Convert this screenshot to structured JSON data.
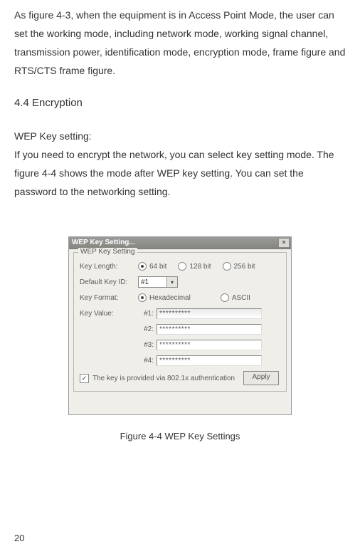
{
  "paragraphs": {
    "intro": "As figure 4-3, when the equipment is in Access Point Mode, the user can set the working mode, including network mode, working signal channel, transmission power, identification mode, encryption mode, frame figure and RTS/CTS frame figure.",
    "heading": "4.4 Encryption",
    "wep_title": "WEP Key setting:",
    "wep_body": "If you need to encrypt the network, you can select key setting mode. The figure 4-4 shows the mode after WEP key setting. You can set the password to the networking setting."
  },
  "dialog": {
    "title": "WEP Key Setting...",
    "close_glyph": "×",
    "groupbox_label": "WEP Key Setting",
    "labels": {
      "key_length": "Key Length:",
      "default_key_id": "Default Key ID:",
      "key_format": "Key Format:",
      "key_value": "Key Value:"
    },
    "key_length_options": {
      "opt64": "64 bit",
      "opt128": "128 bit",
      "opt256": "256 bit"
    },
    "default_key_id_value": "#1",
    "key_format_options": {
      "hex": "Hexadecimal",
      "ascii": "ASCII"
    },
    "key_rows": {
      "k1": "#1:",
      "k2": "#2:",
      "k3": "#3:",
      "k4": "#4:"
    },
    "key_values": {
      "v1": "**********",
      "v2": "**********",
      "v3": "**********",
      "v4": "**********"
    },
    "checkbox_label": "The key is provided via 802.1x authentication",
    "checkbox_checked": "✓",
    "apply_label": "Apply"
  },
  "caption": "Figure 4-4 WEP Key Settings",
  "page_number": "20"
}
